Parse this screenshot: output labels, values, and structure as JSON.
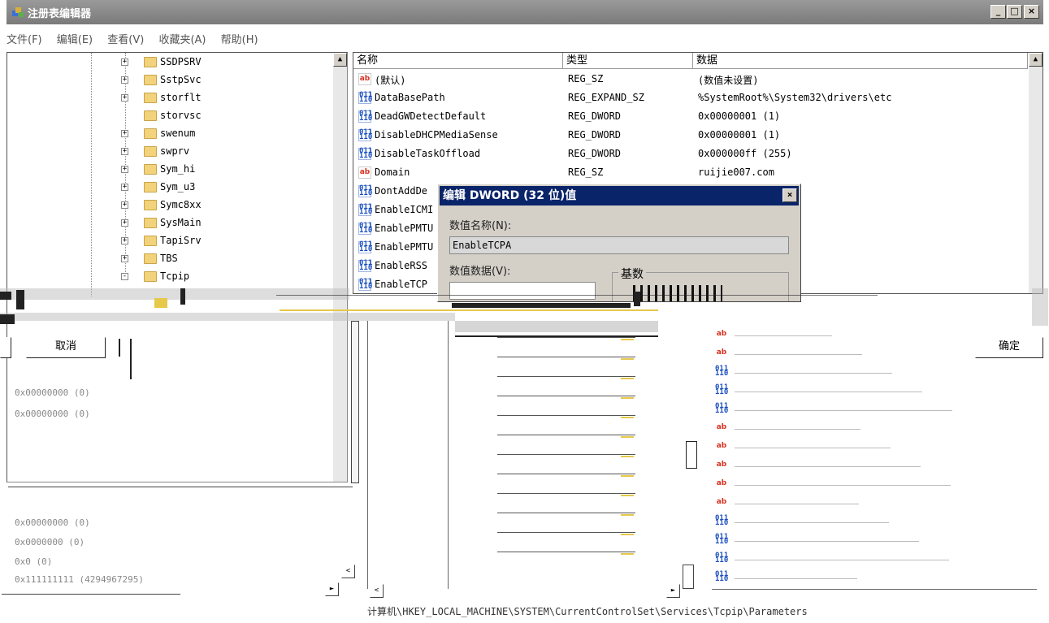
{
  "window": {
    "title": "注册表编辑器",
    "buttons": [
      "_",
      "□",
      "×"
    ]
  },
  "menu": [
    "文件(F)",
    "编辑(E)",
    "查看(V)",
    "收藏夹(A)",
    "帮助(H)"
  ],
  "tree": {
    "items": [
      {
        "name": "SSDPSRV",
        "expander": "+"
      },
      {
        "name": "SstpSvc",
        "expander": "+"
      },
      {
        "name": "storflt",
        "expander": "+"
      },
      {
        "name": "storvsc",
        "expander": ""
      },
      {
        "name": "swenum",
        "expander": "+"
      },
      {
        "name": "swprv",
        "expander": "+"
      },
      {
        "name": "Sym_hi",
        "expander": "+"
      },
      {
        "name": "Sym_u3",
        "expander": "+"
      },
      {
        "name": "Symc8xx",
        "expander": "+"
      },
      {
        "name": "SysMain",
        "expander": "+"
      },
      {
        "name": "TapiSrv",
        "expander": "+"
      },
      {
        "name": "TBS",
        "expander": "+"
      },
      {
        "name": "Tcpip",
        "expander": "-"
      }
    ]
  },
  "list": {
    "headers": {
      "name": "名称",
      "type": "类型",
      "data": "数据"
    },
    "rows": [
      {
        "icon": "ab",
        "name": "(默认)",
        "type": "REG_SZ",
        "data": "(数值未设置)"
      },
      {
        "icon": "bin",
        "name": "DataBasePath",
        "type": "REG_EXPAND_SZ",
        "data": "%SystemRoot%\\System32\\drivers\\etc"
      },
      {
        "icon": "bin",
        "name": "DeadGWDetectDefault",
        "type": "REG_DWORD",
        "data": "0x00000001 (1)"
      },
      {
        "icon": "bin",
        "name": "DisableDHCPMediaSense",
        "type": "REG_DWORD",
        "data": "0x00000001 (1)"
      },
      {
        "icon": "bin",
        "name": "DisableTaskOffload",
        "type": "REG_DWORD",
        "data": "0x000000ff (255)"
      },
      {
        "icon": "ab",
        "name": "Domain",
        "type": "REG_SZ",
        "data": "ruijie007.com"
      },
      {
        "icon": "bin",
        "name": "DontAddDe",
        "type": "",
        "data": ""
      },
      {
        "icon": "bin",
        "name": "EnableICMI",
        "type": "",
        "data": ""
      },
      {
        "icon": "bin",
        "name": "EnablePMTU",
        "type": "",
        "data": ""
      },
      {
        "icon": "bin",
        "name": "EnablePMTU",
        "type": "",
        "data": ""
      },
      {
        "icon": "bin",
        "name": "EnableRSS",
        "type": "",
        "data": ""
      },
      {
        "icon": "bin",
        "name": "EnableTCP",
        "type": "",
        "data": ""
      }
    ]
  },
  "dialog": {
    "title": "编辑 DWORD (32 位)值",
    "close": "×",
    "value_name_label": "数值名称(N):",
    "value_name": "EnableTCPA",
    "value_data_label": "数值数据(V):",
    "base_label": "基数"
  },
  "lower": {
    "cancel_button": "取消",
    "ok_button": "确定",
    "left_values": [
      "0x00000000 (0)",
      "0x0000000 (0)",
      "0x0 (0)",
      "0x111111111 (4294967295)"
    ],
    "scroll_left": "<",
    "scroll_right": "►"
  },
  "status": "计算机\\HKEY_LOCAL_MACHINE\\SYSTEM\\CurrentControlSet\\Services\\Tcpip\\Parameters"
}
